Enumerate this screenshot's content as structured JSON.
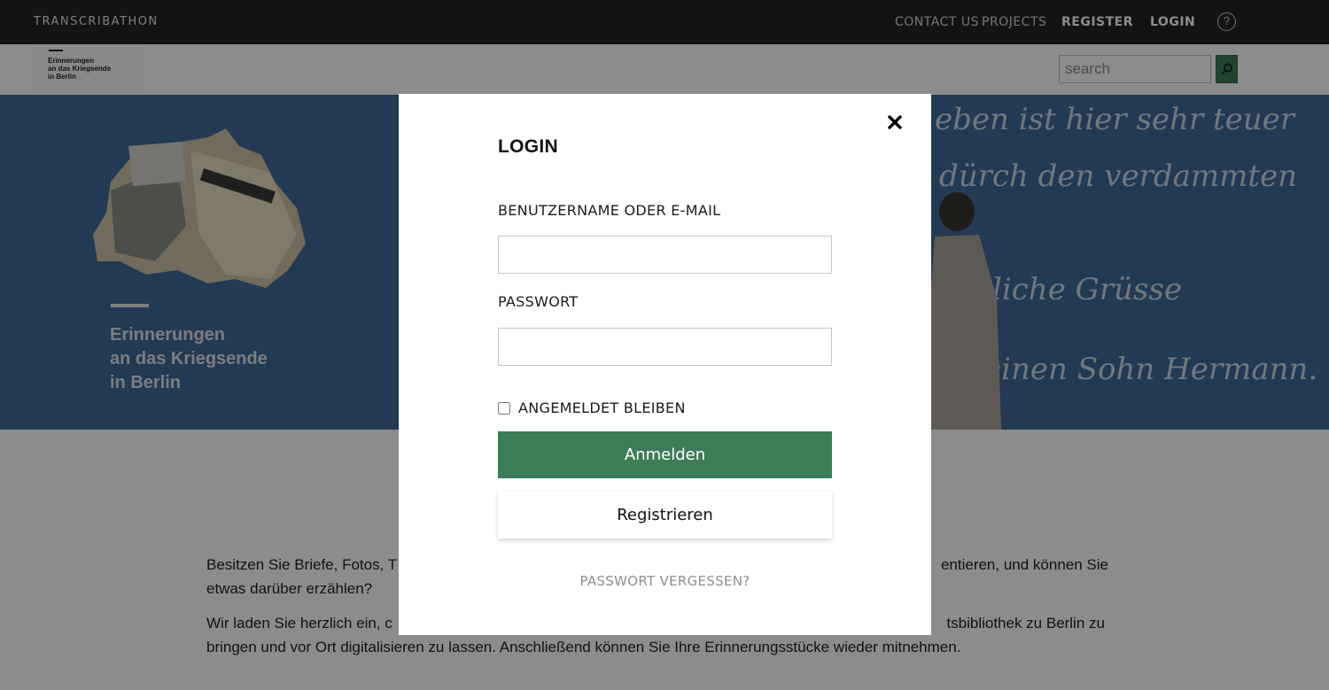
{
  "brand": "TRANSCRIBATHON",
  "nav": {
    "contact": "CONTACT US",
    "projects": "PROJECTS",
    "register": "REGISTER",
    "login": "LOGIN",
    "help": "?"
  },
  "project_logo": {
    "line1": "Erinnerungen",
    "line2": "an das Kriegsende",
    "line3": "in Berlin"
  },
  "search": {
    "placeholder": "search"
  },
  "hero": {
    "title_line1": "Erinnerungen",
    "title_line2": "an das Kriegsende",
    "title_line3": "in Berlin",
    "script_lines": [
      "eben ist hier sehr teuer",
      "dürch den verdammten",
      "liche Grüsse",
      "einen Sohn Hermann."
    ]
  },
  "content": {
    "p1_left": "Besitzen Sie Briefe, Fotos, T",
    "p1_right": "entieren, und können Sie",
    "p1_line2": "etwas darüber erzählen?",
    "p2_left": "Wir laden Sie herzlich ein, c",
    "p2_right": "tsbibliothek zu Berlin zu",
    "p2_line2": "bringen und vor Ort digitalisieren zu lassen. Anschließend können Sie Ihre Erinnerungsstücke wieder mitnehmen."
  },
  "modal": {
    "title": "LOGIN",
    "username_label": "BENUTZERNAME ODER E-MAIL",
    "username_value": "",
    "password_label": "PASSWORT",
    "password_value": "",
    "remember_label": "ANGEMELDET BLEIBEN",
    "submit_label": "Anmelden",
    "register_label": "Registrieren",
    "forgot_label": "PASSWORT VERGESSEN?"
  },
  "colors": {
    "nav_bg": "#242424",
    "accent_green": "#3d7d57",
    "hero_blue": "#3f6a98"
  }
}
